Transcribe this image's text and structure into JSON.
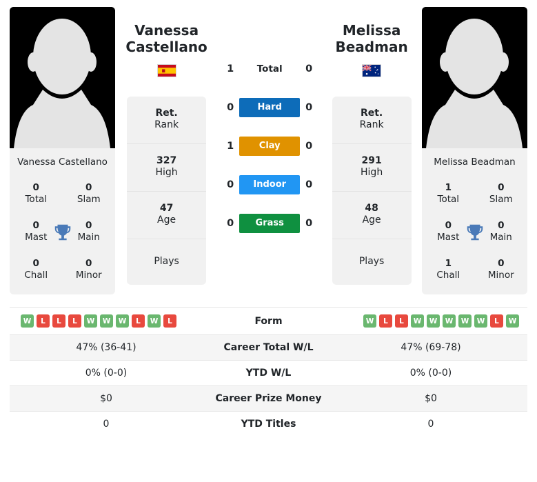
{
  "players": {
    "left": {
      "name_line1": "Vanessa",
      "name_line2": "Castellano",
      "full_name": "Vanessa Castellano",
      "country": "Spain",
      "flag_icon": "flag-spain-icon",
      "rank_value": "Ret.",
      "rank_label": "Rank",
      "high_value": "327",
      "high_label": "High",
      "age_value": "47",
      "age_label": "Age",
      "plays_label": "Plays",
      "plays_value": "",
      "titles": {
        "total_value": "0",
        "total_label": "Total",
        "slam_value": "0",
        "slam_label": "Slam",
        "mast_value": "0",
        "mast_label": "Mast",
        "main_value": "0",
        "main_label": "Main",
        "chall_value": "0",
        "chall_label": "Chall",
        "minor_value": "0",
        "minor_label": "Minor"
      },
      "form": [
        "W",
        "L",
        "L",
        "L",
        "W",
        "W",
        "W",
        "L",
        "W",
        "L"
      ],
      "career_total_wl": "47% (36-41)",
      "ytd_wl": "0% (0-0)",
      "career_prize_money": "$0",
      "ytd_titles": "0"
    },
    "right": {
      "name_line1": "Melissa",
      "name_line2": "Beadman",
      "full_name": "Melissa Beadman",
      "country": "Australia",
      "flag_icon": "flag-australia-icon",
      "rank_value": "Ret.",
      "rank_label": "Rank",
      "high_value": "291",
      "high_label": "High",
      "age_value": "48",
      "age_label": "Age",
      "plays_label": "Plays",
      "plays_value": "",
      "titles": {
        "total_value": "1",
        "total_label": "Total",
        "slam_value": "0",
        "slam_label": "Slam",
        "mast_value": "0",
        "mast_label": "Mast",
        "main_value": "0",
        "main_label": "Main",
        "chall_value": "1",
        "chall_label": "Chall",
        "minor_value": "0",
        "minor_label": "Minor"
      },
      "form": [
        "W",
        "L",
        "L",
        "W",
        "W",
        "W",
        "W",
        "W",
        "L",
        "W"
      ],
      "career_total_wl": "47% (69-78)",
      "ytd_wl": "0% (0-0)",
      "career_prize_money": "$0",
      "ytd_titles": "0"
    }
  },
  "head_to_head": [
    {
      "label": "Total",
      "left": "1",
      "right": "0",
      "style": "plain",
      "color": ""
    },
    {
      "label": "Hard",
      "left": "0",
      "right": "0",
      "style": "hard",
      "color": "#0d6cb9"
    },
    {
      "label": "Clay",
      "left": "1",
      "right": "0",
      "style": "clay",
      "color": "#e09200"
    },
    {
      "label": "Indoor",
      "left": "0",
      "right": "0",
      "style": "indoor",
      "color": "#2196f3"
    },
    {
      "label": "Grass",
      "left": "0",
      "right": "0",
      "style": "grass",
      "color": "#0f9040"
    }
  ],
  "comparison_rows": [
    {
      "label": "Form",
      "left": "",
      "right": ""
    },
    {
      "label": "Career Total W/L",
      "left": "47% (36-41)",
      "right": "47% (69-78)"
    },
    {
      "label": "YTD W/L",
      "left": "0% (0-0)",
      "right": "0% (0-0)"
    },
    {
      "label": "Career Prize Money",
      "left": "$0",
      "right": "$0"
    },
    {
      "label": "YTD Titles",
      "left": "0",
      "right": "0"
    }
  ],
  "icons": {
    "trophy": "trophy-icon",
    "avatar": "avatar-placeholder-icon"
  },
  "colors": {
    "win": "#6ab76f",
    "loss": "#e8493e",
    "card_bg": "#f1f1f1",
    "trophy": "#4a7ab8"
  }
}
